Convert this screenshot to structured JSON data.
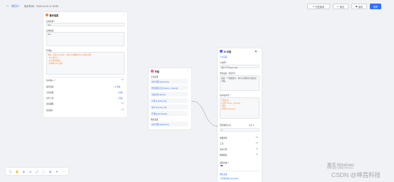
{
  "topbar": {
    "back_icon": "arrow-left-icon",
    "app_title": "知识IT",
    "save_time": "保存时间：2024-01-03 11:39:35",
    "buttons": {
      "history": "历史版本",
      "debug": "调试",
      "save": "保存",
      "publish": "发布"
    }
  },
  "basic_node": {
    "title": "基本信息",
    "name_label": "应用名称 *",
    "name_value": "test",
    "desc_label": "应用描述",
    "desc_value": "test",
    "opening_label": "开场白",
    "opening_value": "你好，我是 test 助手，你可以向我提问 test 相关问题。\n- test 是什么？\n- test 如何使用？\n- 有哪些 test 功能？",
    "settings": [
      {
        "label": "用户输入 ?",
        "action": "",
        "toggle": false
      },
      {
        "label": "插件选项",
        "action": "⊕ 添加",
        "toggle": null
      },
      {
        "label": "全局变量",
        "action": "+ 添加",
        "toggle": null
      },
      {
        "label": "文件上传",
        "action": "+ 添加",
        "toggle": null
      },
      {
        "label": "语音播报",
        "action": "",
        "toggle": false
      },
      {
        "label": "语音输入",
        "action": "",
        "toggle": false
      }
    ]
  },
  "start_node": {
    "title": "开始",
    "section": "全局变量",
    "params": [
      "用户问题 {{question}}",
      "历史聊天记录 {{history_context}}",
      "当前时间 {{time}}",
      "对话 ID {{chat_id}}",
      "用户 ID {{user_id}}",
      "开场白 {{prologue}}"
    ],
    "section2": "输出变量",
    "section2_param": "用户问题 {{question}}"
  },
  "ai_node": {
    "title": "AI 对话",
    "section": "节点设置",
    "model_label": "AI 模型 *",
    "model_value": "通义千问 qwen-max",
    "role_label": "角色设定（提示词）",
    "role_value": "你是一个智能助手，你可以回答用户提出的问题。",
    "prompt_label": "用户提示词 *",
    "prompt_value": "已知信息：\n{{开始.history_context}}\n问题：\n{{开始.question}}",
    "history_label": "历史聊天记录",
    "history_mode": "大小 ▾",
    "history_value": "1",
    "switches": [
      {
        "label": "函数调用",
        "on": false
      },
      {
        "label": "工具",
        "on": false
      },
      {
        "label": "知识引用",
        "on": false
      },
      {
        "label": "联网搜索",
        "on": false
      },
      {
        "label": "返回内容 ?",
        "on": true
      }
    ],
    "output_section": "输出变量",
    "output_param": "AI 回答内容 {{answer}}"
  },
  "bottom_tools": [
    "select-icon",
    "pan-icon",
    "zoom-in-icon",
    "zoom-out-icon",
    "fit-view-icon",
    "fullscreen-icon",
    "layout-icon",
    "magic-icon",
    "more-icon"
  ],
  "bottom_glyphs": [
    "⤡",
    "✋",
    "⊕",
    "⊖",
    "⤢",
    "⛶",
    "⊞",
    "✦",
    "⋯"
  ],
  "watermark": {
    "line1": "激活 Windows",
    "line2": "转到\"设置\"以激活 Windows。",
    "csdn": "CSDN @坤昌科技"
  },
  "colors": {
    "accent": "#3370ff",
    "basic_icon": "#ff8a3c",
    "start_icon": "#ff5fa2",
    "ai_icon": "#5b6bff"
  }
}
